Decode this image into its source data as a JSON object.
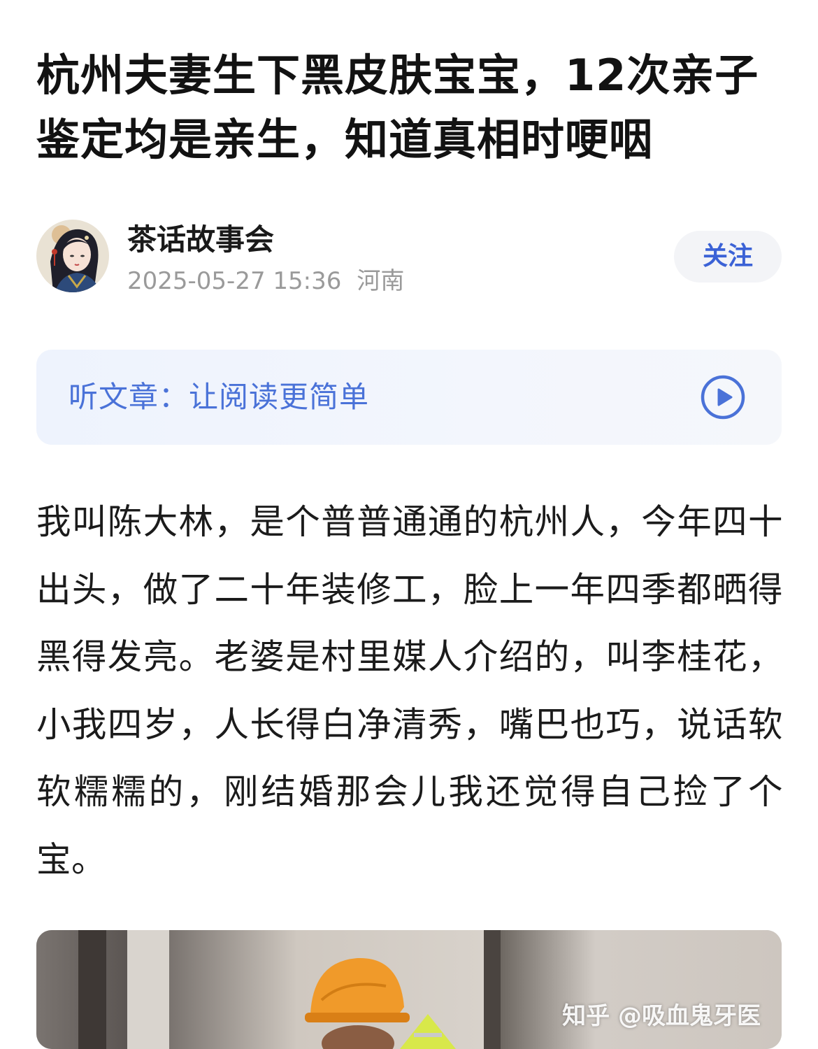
{
  "article": {
    "title": "杭州夫妻生下黑皮肤宝宝，12次亲子鉴定均是亲生，知道真相时哽咽",
    "author": {
      "name": "茶话故事会",
      "timestamp": "2025-05-27 15:36",
      "region": "河南",
      "follow_label": "关注",
      "avatar_icon": "avatar-illustrated-woman"
    },
    "listen": {
      "label": "听文章：让阅读更简单",
      "icon": "play-circle-icon",
      "accent": "#4a72d8"
    },
    "body": "我叫陈大林，是个普普通通的杭州人，今年四十出头，做了二十年装修工，脸上一年四季都晒得黑得发亮。老婆是村里媒人介绍的，叫李桂花，小我四岁，人长得白净清秀，嘴巴也巧，说话软软糯糯的，刚结婚那会儿我还觉得自己捡了个宝。",
    "image": {
      "watermark": "知乎 @吸血鬼牙医"
    }
  },
  "colors": {
    "follow_text": "#3b62d6",
    "follow_bg": "#f3f4f7",
    "meta_text": "#9a9a9a"
  }
}
